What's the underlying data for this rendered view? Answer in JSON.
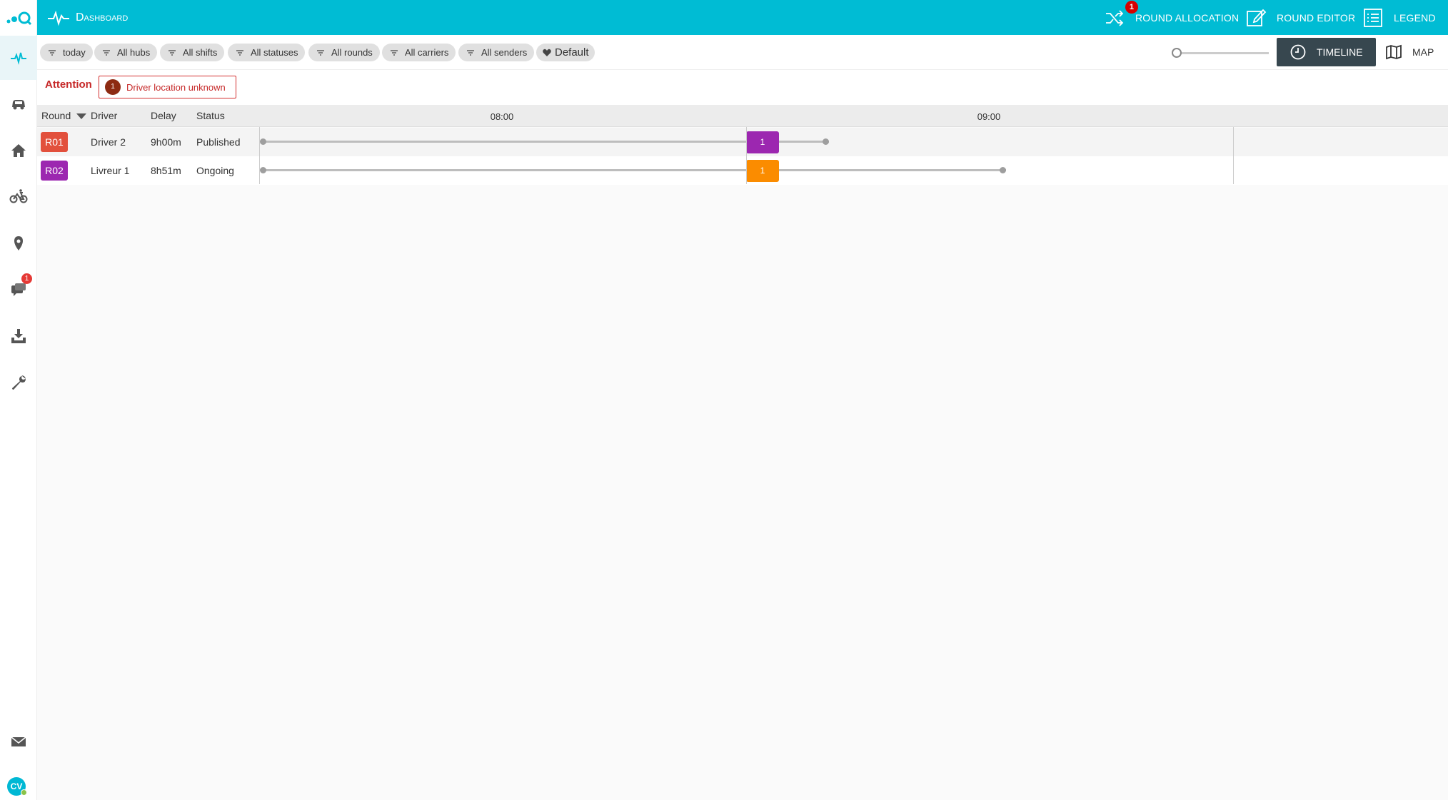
{
  "header": {
    "title": "Dashboard",
    "actions": [
      {
        "label": "ROUND ALLOCATION",
        "icon": "shuffle-icon",
        "badge": "1"
      },
      {
        "label": "ROUND EDITOR",
        "icon": "edit-icon"
      },
      {
        "label": "LEGEND",
        "icon": "list-icon"
      }
    ]
  },
  "sidebar": {
    "items": [
      {
        "name": "dashboard",
        "icon": "pulse-icon"
      },
      {
        "name": "vehicles",
        "icon": "car-icon"
      },
      {
        "name": "hubs",
        "icon": "home-icon"
      },
      {
        "name": "drivers",
        "icon": "bicycle-icon"
      },
      {
        "name": "locations",
        "icon": "map-pin-icon"
      },
      {
        "name": "messages",
        "icon": "chat-icon",
        "badge": "1"
      },
      {
        "name": "import",
        "icon": "download-icon"
      },
      {
        "name": "settings",
        "icon": "wrench-icon"
      }
    ],
    "mail_icon": "mail-icon",
    "avatar": "CV"
  },
  "filters": [
    "today",
    "All hubs",
    "All shifts",
    "All statuses",
    "All rounds",
    "All carriers",
    "All senders"
  ],
  "favorite_filter": "Default",
  "view_toggle": {
    "timeline": "TIMELINE",
    "map": "MAP",
    "active": "timeline"
  },
  "zoom_level": 0,
  "attention": {
    "label": "Attention",
    "alerts": [
      {
        "count": "1",
        "text": "Driver location unknown"
      }
    ]
  },
  "table": {
    "columns": {
      "round": "Round",
      "driver": "Driver",
      "delay": "Delay",
      "status": "Status"
    },
    "time_ticks": [
      "08:00",
      "09:00"
    ],
    "rows": [
      {
        "round": "R01",
        "round_color": "#e2503c",
        "driver": "Driver 2",
        "delay": "9h00m",
        "status": "Published",
        "stop_label": "1",
        "stop_color": "#9c27b0"
      },
      {
        "round": "R02",
        "round_color": "#9c27b0",
        "driver": "Livreur 1",
        "delay": "8h51m",
        "status": "Ongoing",
        "stop_label": "1",
        "stop_color": "#fb8c00"
      }
    ]
  },
  "colors": {
    "primary": "#00bcd4",
    "alert": "#c62828",
    "active_view": "#37474f"
  }
}
